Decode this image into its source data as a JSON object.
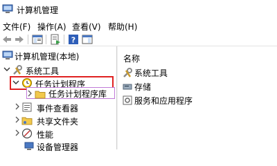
{
  "window": {
    "title": "计算机管理"
  },
  "menu": [
    "文件(F)",
    "操作(A)",
    "查看(V)",
    "帮助(H)"
  ],
  "tree": {
    "root": "计算机管理(本地)",
    "system_tools": "系统工具",
    "task_scheduler": "任务计划程序",
    "task_scheduler_library": "任务计划程序库",
    "event_viewer": "事件查看器",
    "shared_folders": "共享文件夹",
    "performance": "性能",
    "device_manager": "设备管理器"
  },
  "list": {
    "column_name": "名称",
    "items": [
      "系统工具",
      "存储",
      "服务和应用程序"
    ]
  },
  "colors": {
    "highlight": "#e02020",
    "selection": "#c07ad8",
    "clock_yellow": "#f5c400"
  }
}
